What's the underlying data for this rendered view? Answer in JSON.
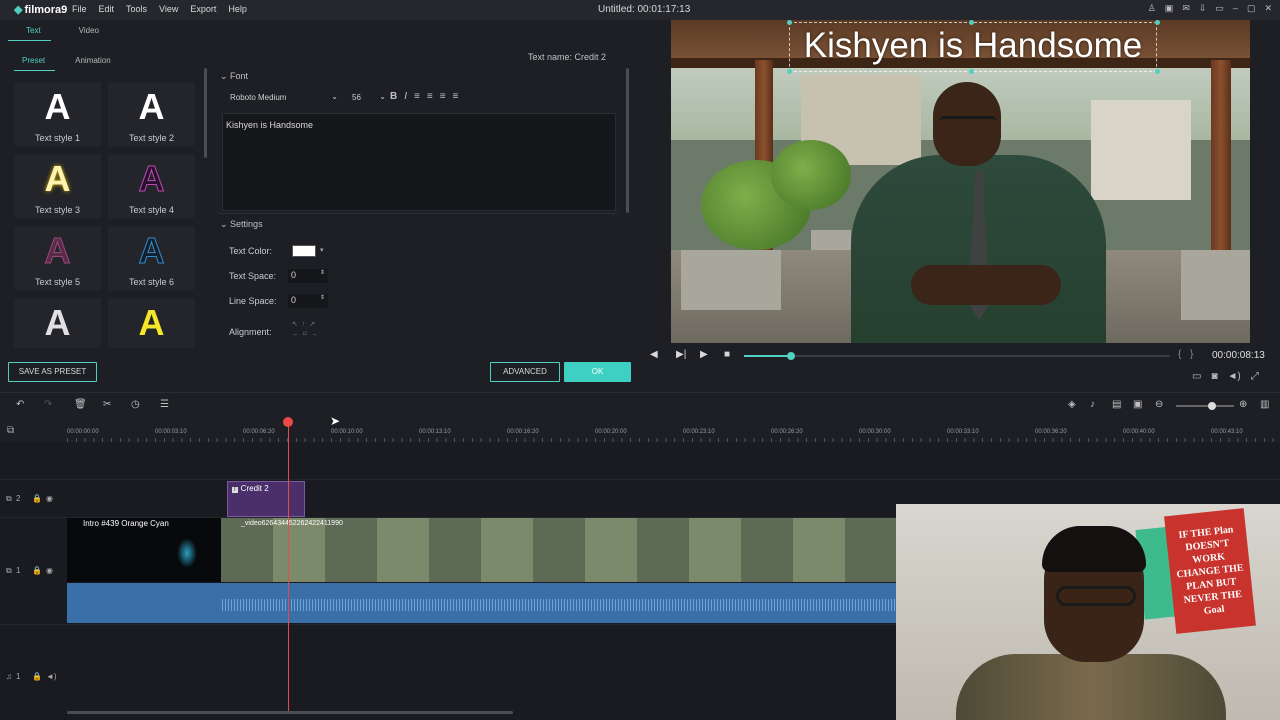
{
  "app": {
    "logo": "filmora9",
    "menu": [
      "File",
      "Edit",
      "Tools",
      "View",
      "Export",
      "Help"
    ],
    "window_title": "Untitled:  00:01:17:13"
  },
  "editor": {
    "tabs": [
      "Text",
      "Video"
    ],
    "subtabs": [
      "Preset",
      "Animation"
    ],
    "text_name": "Text name: Credit 2",
    "styles": [
      {
        "label": "Text style 1",
        "glyph": "A",
        "color": "#ffffff"
      },
      {
        "label": "Text style 2",
        "glyph": "A",
        "color": "#ffffff"
      },
      {
        "label": "Text style 3",
        "glyph": "A",
        "color": "#fff3b0"
      },
      {
        "label": "Text style 4",
        "glyph": "A",
        "color": "#5a2a6a"
      },
      {
        "label": "Text style 5",
        "glyph": "A",
        "color": "#6a2a4a"
      },
      {
        "label": "Text style 6",
        "glyph": "A",
        "color": "#1a3a5a"
      },
      {
        "label": "",
        "glyph": "A",
        "color": "#e0e0e0"
      },
      {
        "label": "",
        "glyph": "A",
        "color": "#f5e62a"
      }
    ],
    "font_section": "Font",
    "font_name": "Roboto Medium",
    "font_size": "56",
    "text_content": "Kishyen is Handsome",
    "settings_section": "Settings",
    "text_color_label": "Text Color:",
    "text_space_label": "Text Space:",
    "text_space_value": "0",
    "line_space_label": "Line Space:",
    "line_space_value": "0",
    "alignment_label": "Alignment:",
    "save_preset": "SAVE AS PRESET",
    "advanced": "ADVANCED",
    "ok": "OK"
  },
  "preview": {
    "overlay_text": "Kishyen is Handsome",
    "timecode": "00:00:08:13",
    "seek_progress": 0.11
  },
  "timeline": {
    "ruler": [
      "00:00:00:00",
      "00:00:03:10",
      "00:00:06:20",
      "00:00:10:00",
      "00:00:13:10",
      "00:00:16:20",
      "00:00:20:00",
      "00:00:23:10",
      "00:00:26:20",
      "00:00:30:00",
      "00:00:33:10",
      "00:00:36:20",
      "00:00:40:00",
      "00:00:43:10"
    ],
    "track2_label": "2",
    "track1_label": "1",
    "audio_label": "1",
    "title_clip": "Credit 2",
    "intro_clip": "Intro #439 Orange Cyan",
    "video_clip": "_video626434452262422411990"
  },
  "colors": {
    "accent": "#3ed0c2",
    "playhead": "#e84a4a",
    "title_clip": "#4a2f6b",
    "audio": "#3a6fa8"
  },
  "webcam": {
    "poster_text": "IF THE Plan DOESN'T WORK CHANGE THE PLAN BUT NEVER THE Goal"
  }
}
